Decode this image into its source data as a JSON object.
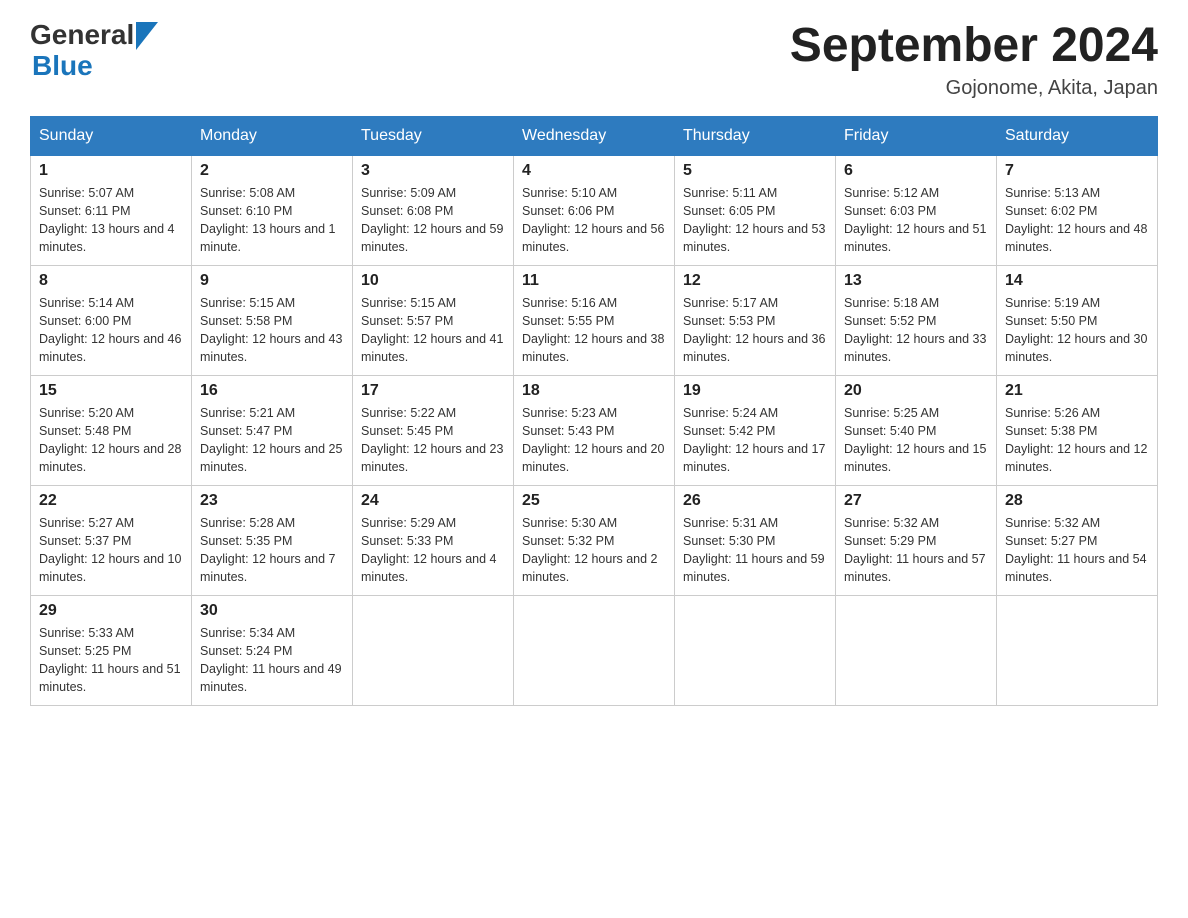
{
  "logo": {
    "text_general": "General",
    "text_blue": "Blue"
  },
  "title": "September 2024",
  "subtitle": "Gojonome, Akita, Japan",
  "days_of_week": [
    "Sunday",
    "Monday",
    "Tuesday",
    "Wednesday",
    "Thursday",
    "Friday",
    "Saturday"
  ],
  "weeks": [
    [
      {
        "day": "1",
        "sunrise": "5:07 AM",
        "sunset": "6:11 PM",
        "daylight": "13 hours and 4 minutes."
      },
      {
        "day": "2",
        "sunrise": "5:08 AM",
        "sunset": "6:10 PM",
        "daylight": "13 hours and 1 minute."
      },
      {
        "day": "3",
        "sunrise": "5:09 AM",
        "sunset": "6:08 PM",
        "daylight": "12 hours and 59 minutes."
      },
      {
        "day": "4",
        "sunrise": "5:10 AM",
        "sunset": "6:06 PM",
        "daylight": "12 hours and 56 minutes."
      },
      {
        "day": "5",
        "sunrise": "5:11 AM",
        "sunset": "6:05 PM",
        "daylight": "12 hours and 53 minutes."
      },
      {
        "day": "6",
        "sunrise": "5:12 AM",
        "sunset": "6:03 PM",
        "daylight": "12 hours and 51 minutes."
      },
      {
        "day": "7",
        "sunrise": "5:13 AM",
        "sunset": "6:02 PM",
        "daylight": "12 hours and 48 minutes."
      }
    ],
    [
      {
        "day": "8",
        "sunrise": "5:14 AM",
        "sunset": "6:00 PM",
        "daylight": "12 hours and 46 minutes."
      },
      {
        "day": "9",
        "sunrise": "5:15 AM",
        "sunset": "5:58 PM",
        "daylight": "12 hours and 43 minutes."
      },
      {
        "day": "10",
        "sunrise": "5:15 AM",
        "sunset": "5:57 PM",
        "daylight": "12 hours and 41 minutes."
      },
      {
        "day": "11",
        "sunrise": "5:16 AM",
        "sunset": "5:55 PM",
        "daylight": "12 hours and 38 minutes."
      },
      {
        "day": "12",
        "sunrise": "5:17 AM",
        "sunset": "5:53 PM",
        "daylight": "12 hours and 36 minutes."
      },
      {
        "day": "13",
        "sunrise": "5:18 AM",
        "sunset": "5:52 PM",
        "daylight": "12 hours and 33 minutes."
      },
      {
        "day": "14",
        "sunrise": "5:19 AM",
        "sunset": "5:50 PM",
        "daylight": "12 hours and 30 minutes."
      }
    ],
    [
      {
        "day": "15",
        "sunrise": "5:20 AM",
        "sunset": "5:48 PM",
        "daylight": "12 hours and 28 minutes."
      },
      {
        "day": "16",
        "sunrise": "5:21 AM",
        "sunset": "5:47 PM",
        "daylight": "12 hours and 25 minutes."
      },
      {
        "day": "17",
        "sunrise": "5:22 AM",
        "sunset": "5:45 PM",
        "daylight": "12 hours and 23 minutes."
      },
      {
        "day": "18",
        "sunrise": "5:23 AM",
        "sunset": "5:43 PM",
        "daylight": "12 hours and 20 minutes."
      },
      {
        "day": "19",
        "sunrise": "5:24 AM",
        "sunset": "5:42 PM",
        "daylight": "12 hours and 17 minutes."
      },
      {
        "day": "20",
        "sunrise": "5:25 AM",
        "sunset": "5:40 PM",
        "daylight": "12 hours and 15 minutes."
      },
      {
        "day": "21",
        "sunrise": "5:26 AM",
        "sunset": "5:38 PM",
        "daylight": "12 hours and 12 minutes."
      }
    ],
    [
      {
        "day": "22",
        "sunrise": "5:27 AM",
        "sunset": "5:37 PM",
        "daylight": "12 hours and 10 minutes."
      },
      {
        "day": "23",
        "sunrise": "5:28 AM",
        "sunset": "5:35 PM",
        "daylight": "12 hours and 7 minutes."
      },
      {
        "day": "24",
        "sunrise": "5:29 AM",
        "sunset": "5:33 PM",
        "daylight": "12 hours and 4 minutes."
      },
      {
        "day": "25",
        "sunrise": "5:30 AM",
        "sunset": "5:32 PM",
        "daylight": "12 hours and 2 minutes."
      },
      {
        "day": "26",
        "sunrise": "5:31 AM",
        "sunset": "5:30 PM",
        "daylight": "11 hours and 59 minutes."
      },
      {
        "day": "27",
        "sunrise": "5:32 AM",
        "sunset": "5:29 PM",
        "daylight": "11 hours and 57 minutes."
      },
      {
        "day": "28",
        "sunrise": "5:32 AM",
        "sunset": "5:27 PM",
        "daylight": "11 hours and 54 minutes."
      }
    ],
    [
      {
        "day": "29",
        "sunrise": "5:33 AM",
        "sunset": "5:25 PM",
        "daylight": "11 hours and 51 minutes."
      },
      {
        "day": "30",
        "sunrise": "5:34 AM",
        "sunset": "5:24 PM",
        "daylight": "11 hours and 49 minutes."
      },
      null,
      null,
      null,
      null,
      null
    ]
  ]
}
